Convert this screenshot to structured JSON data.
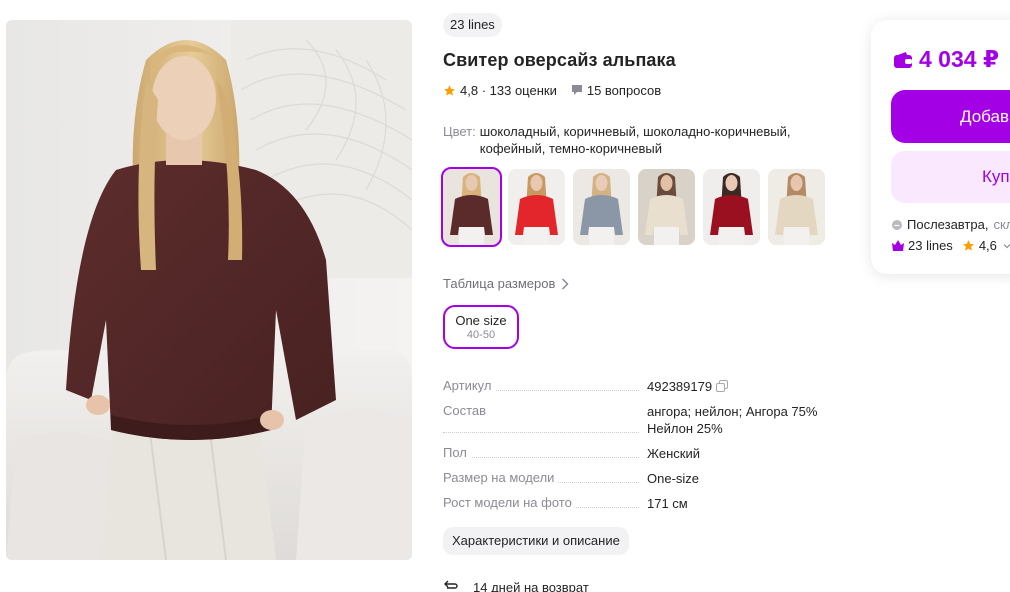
{
  "product": {
    "brand": "23 lines",
    "title": "Свитер оверсайз альпака",
    "rating": "4,8",
    "ratings_count": "133 оценки",
    "questions": "15 вопросов",
    "color_label": "Цвет:",
    "color_value": "шоколадный, коричневый, шоколадно-коричневый, кофейный, темно-коричневый",
    "thumbnails": [
      {
        "name": "chocolate",
        "color": "#5b2a2a",
        "bg": "#e9e4de",
        "skin": "#e7c9b3",
        "hair": "#d9b37a"
      },
      {
        "name": "red",
        "color": "#e3262b",
        "bg": "#f1efee",
        "skin": "#e9c7b0",
        "hair": "#c79a62"
      },
      {
        "name": "grey-blue",
        "color": "#8b96a6",
        "bg": "#ece9e4",
        "skin": "#e9ccb8",
        "hair": "#d4b283"
      },
      {
        "name": "cream-vneck",
        "color": "#e9dfcf",
        "bg": "#d9d2c9",
        "skin": "#e3bfa5",
        "hair": "#6b4c3b"
      },
      {
        "name": "burgundy",
        "color": "#9b1020",
        "bg": "#f0eeec",
        "skin": "#e9c9b6",
        "hair": "#3b2a24"
      },
      {
        "name": "beige",
        "color": "#e4d7c2",
        "bg": "#efece6",
        "skin": "#e6c6ae",
        "hair": "#b38a63"
      }
    ],
    "size_table_label": "Таблица размеров",
    "size": {
      "name": "One size",
      "range": "40-50"
    },
    "specs": [
      {
        "key": "Артикул",
        "value": "492389179"
      },
      {
        "key": "Состав",
        "value": "ангора; нейлон; Ангора 75% Нейлон 25%"
      },
      {
        "key": "Пол",
        "value": "Женский"
      },
      {
        "key": "Размер на модели",
        "value": "One-size"
      },
      {
        "key": "Рост модели на фото",
        "value": "171 см"
      }
    ],
    "characteristics_button": "Характеристики и описание",
    "return_policy": "14 дней на возврат"
  },
  "purchase": {
    "price": "4 034 ₽",
    "add_to_cart": "Добавить в корзину",
    "buy_now": "Купить сейчас",
    "delivery_day": "Послезавтра,",
    "delivery_source": "склад WB",
    "seller_name": "23 lines",
    "seller_rating": "4,6"
  },
  "colors": {
    "accent": "#a400e6",
    "accent_light": "#fae8ff",
    "star": "#ff9d00",
    "sweater_main": "#5b2a2a"
  }
}
